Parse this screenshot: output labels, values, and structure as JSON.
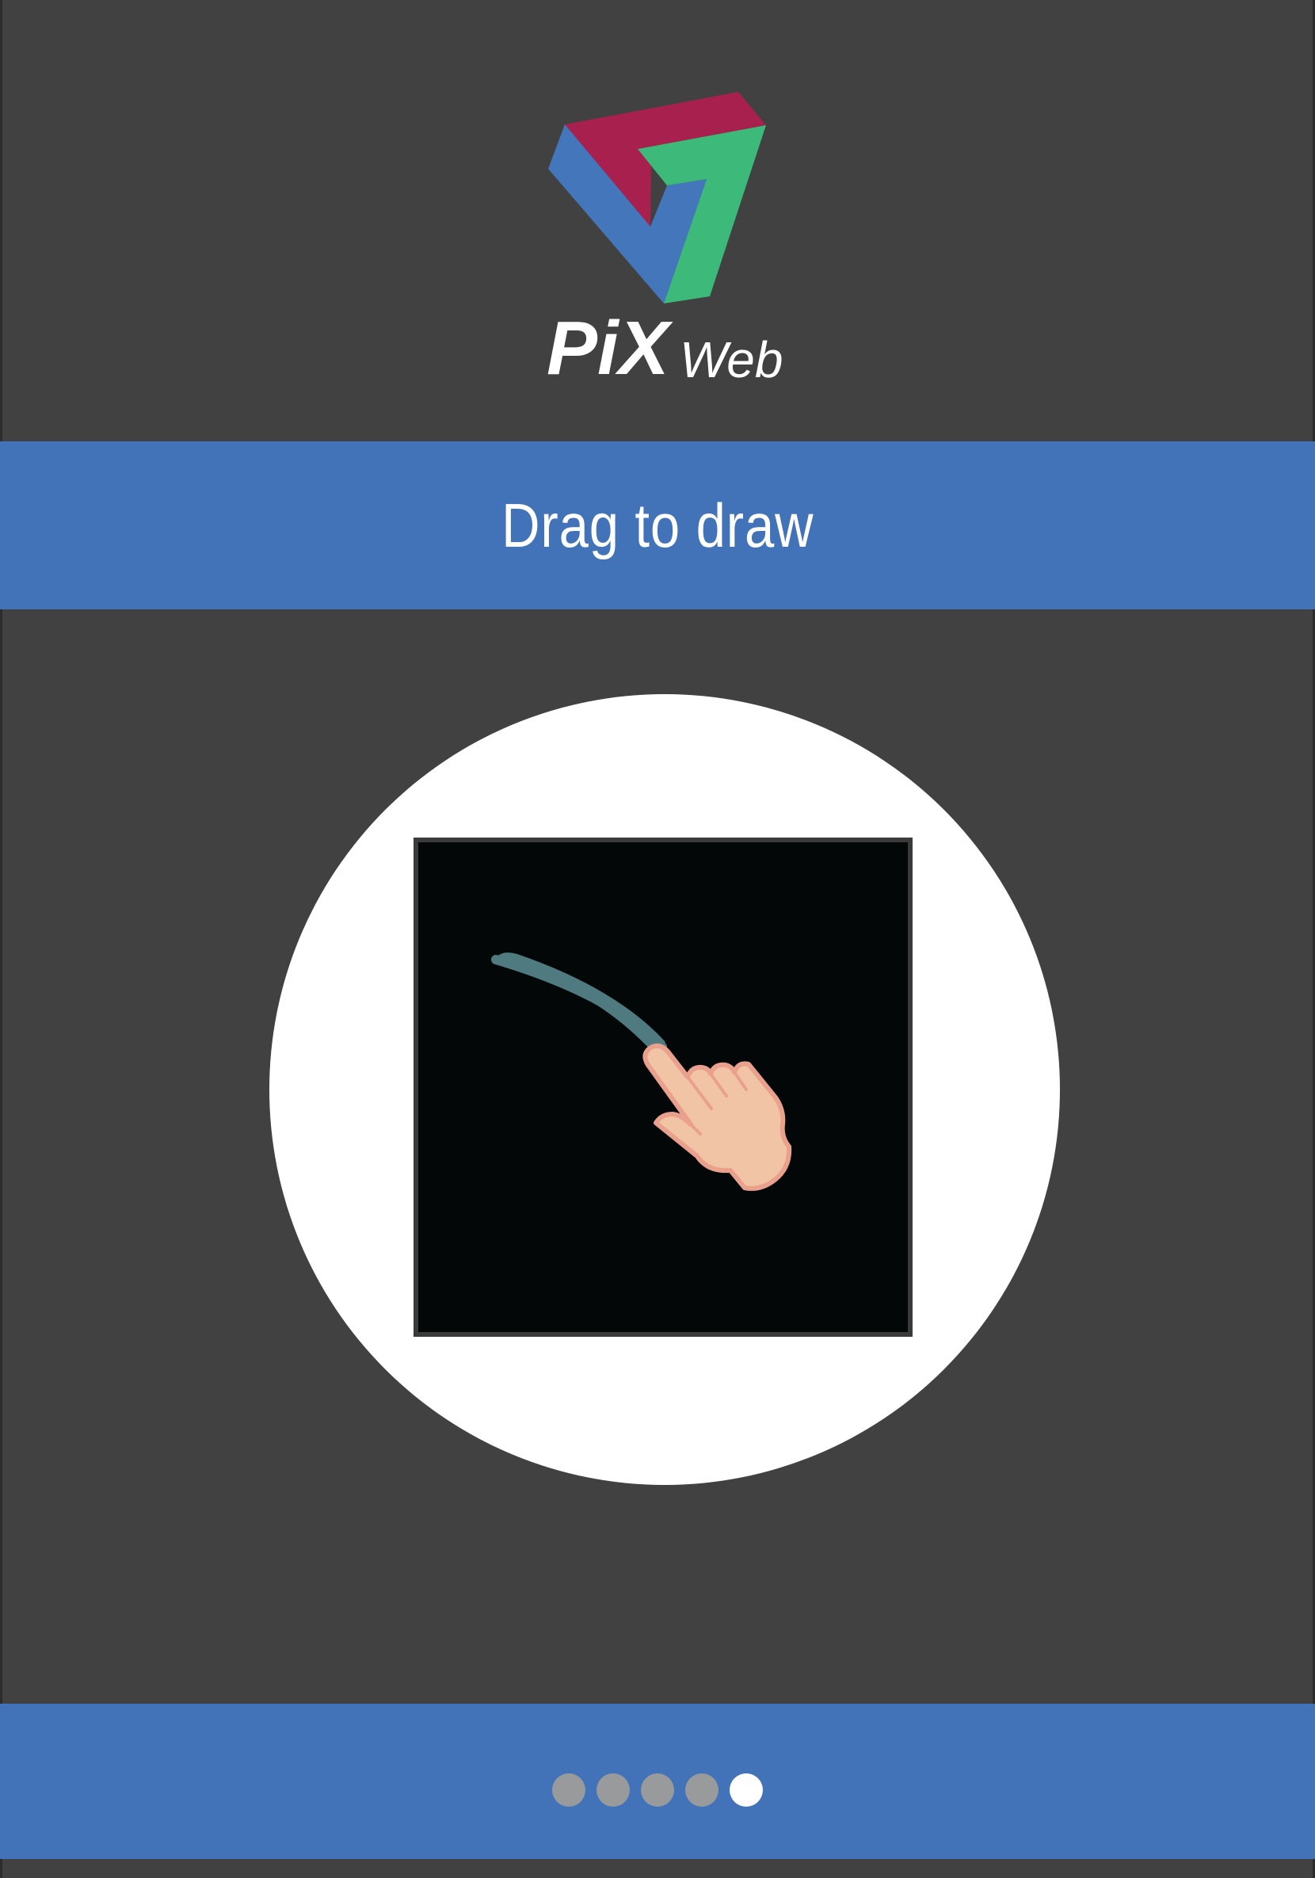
{
  "app": {
    "brand_primary": "PiX",
    "brand_secondary": "Web"
  },
  "colors": {
    "background": "#414141",
    "band": "#4273b9",
    "logo_red": "#a8204d",
    "logo_green": "#3dba7a",
    "logo_blue": "#4376bb",
    "stroke": "#4f7b80",
    "hand": "#f2c4a6",
    "hand_outline": "#e9a08c"
  },
  "onboarding": {
    "title": "Drag to draw",
    "demo_icon": "hand-drawing-icon"
  },
  "pager": {
    "total": 5,
    "current": 5,
    "dots": [
      {
        "active": false
      },
      {
        "active": false
      },
      {
        "active": false
      },
      {
        "active": false
      },
      {
        "active": true
      }
    ]
  }
}
